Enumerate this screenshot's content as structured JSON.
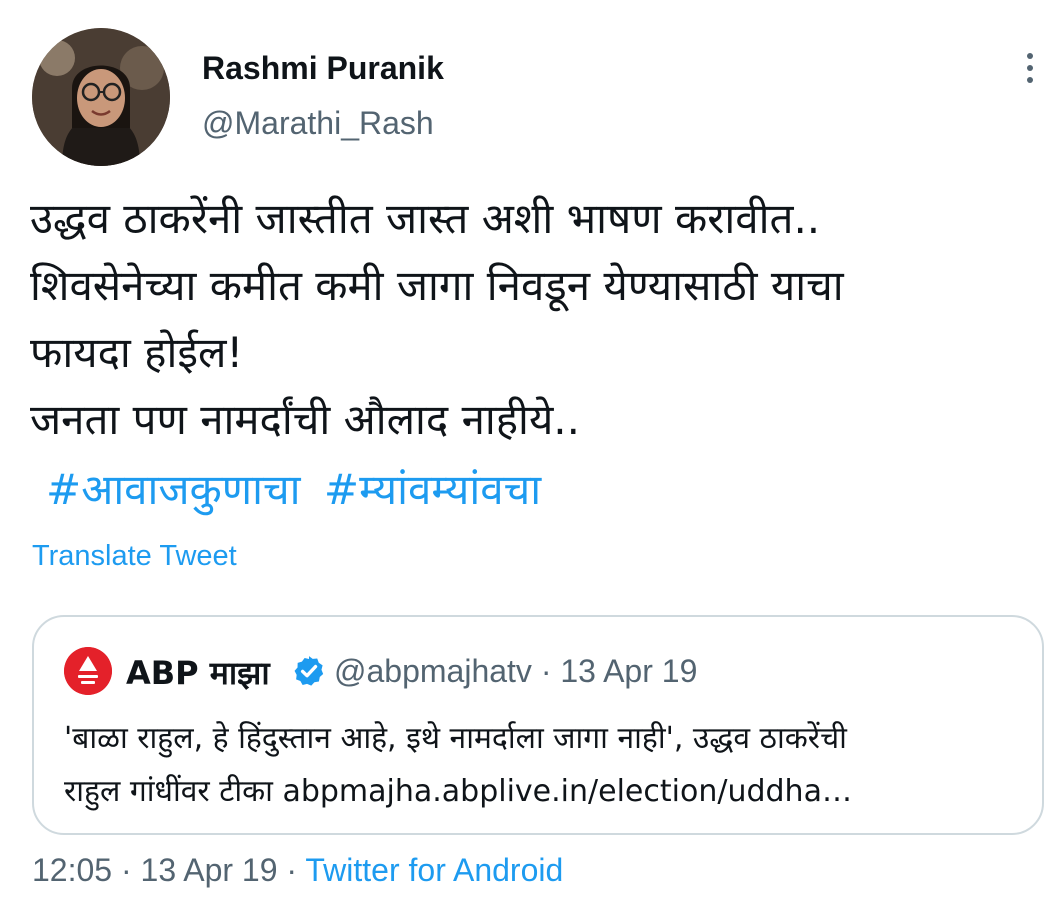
{
  "author": {
    "display_name": "Rashmi Puranik",
    "handle": "@Marathi_Rash",
    "avatar_icon": "user-photo"
  },
  "more_icon": "more-dots-icon",
  "tweet": {
    "lines": [
      "उद्धव ठाकरेंनी जास्तीत जास्त अशी भाषण करावीत..",
      "शिवसेनेच्या कमीत कमी जागा निवडून येण्यासाठी याचा",
      "फायदा होईल!",
      "जनता पण नामर्दांची औलाद नाहीये.."
    ],
    "hashtags": [
      "#आवाजकुणाचा",
      "#म्यांवम्यांवचा"
    ],
    "translate_label": "Translate Tweet"
  },
  "quote": {
    "name": "ABP माझा",
    "verified_icon": "verified-badge-icon",
    "handle": "@abpmajhatv",
    "separator": "·",
    "date": "13 Apr 19",
    "lines": [
      "'बाळा राहुल, हे हिंदुस्तान आहे, इथे नामर्दाला जागा नाही', उद्धव ठाकरेंची",
      "राहुल गांधींवर टीका abpmajha.abplive.in/election/uddha…"
    ]
  },
  "footer": {
    "time": "12:05",
    "sep1": "·",
    "date": "13 Apr 19",
    "sep2": "·",
    "source": "Twitter for Android"
  },
  "colors": {
    "link": "#1d9bf0",
    "muted": "#536471",
    "text": "#0f1419",
    "border": "#cfd9de",
    "abp_red": "#e4212a"
  }
}
